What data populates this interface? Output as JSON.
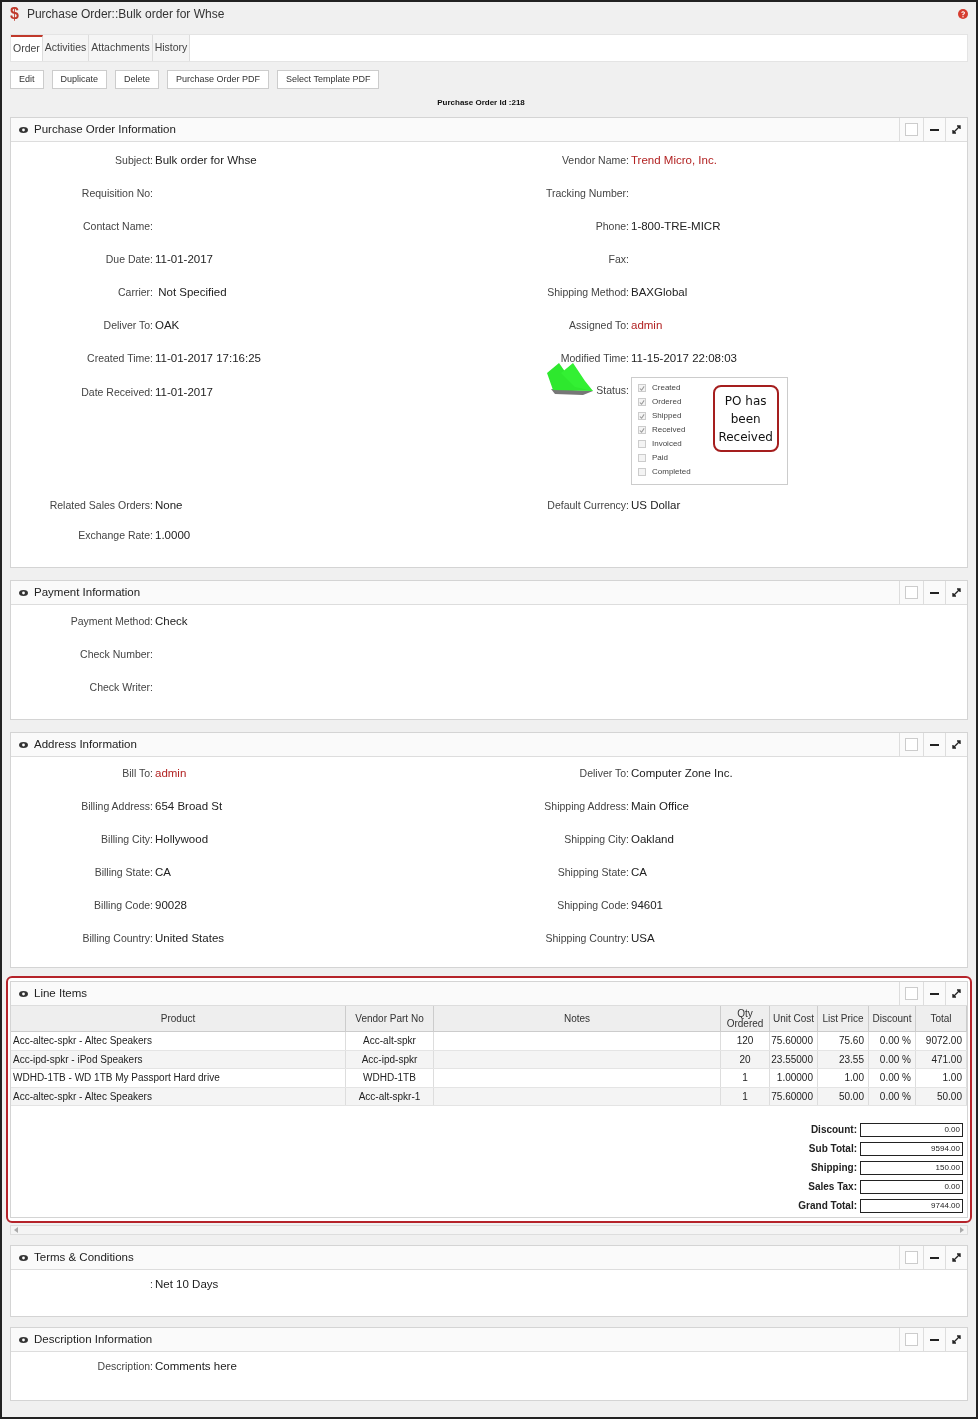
{
  "window": {
    "icon": "$",
    "title": "Purchase Order::Bulk order for Whse"
  },
  "tabs": [
    {
      "label": "Order",
      "selected": true
    },
    {
      "label": "Activities",
      "selected": false
    },
    {
      "label": "Attachments",
      "selected": false
    },
    {
      "label": "History",
      "selected": false
    }
  ],
  "buttons": [
    "Edit",
    "Duplicate",
    "Delete",
    "Purchase Order PDF",
    "Select Template PDF"
  ],
  "record_id": "Purchase Order Id :218",
  "po_info": {
    "title": "Purchase Order Information",
    "rows": [
      [
        {
          "label": "Subject:",
          "value": "Bulk order for Whse"
        },
        {
          "label": "Vendor Name:",
          "value": "Trend Micro, Inc.",
          "link": true
        }
      ],
      [
        {
          "label": "Requisition No:"
        },
        {
          "label": "Tracking Number:"
        }
      ],
      [
        {
          "label": "Contact Name:"
        },
        {
          "label": "Phone:",
          "value": "1-800-TRE-MICR"
        }
      ],
      [
        {
          "label": "Due Date:",
          "value": "11-01-2017"
        },
        {
          "label": "Fax:"
        }
      ],
      [
        {
          "label": "Carrier:",
          "value": " Not Specified"
        },
        {
          "label": "Shipping Method:",
          "value": "BAXGlobal"
        }
      ],
      [
        {
          "label": "Deliver To:",
          "value": "OAK"
        },
        {
          "label": "Assigned To:",
          "value": "admin",
          "link": true
        }
      ],
      [
        {
          "label": "Created Time:",
          "value": "11-01-2017 17:16:25"
        },
        {
          "label": "Modified Time:",
          "value": "11-15-2017 22:08:03"
        }
      ]
    ],
    "date_received": {
      "label": "Date Received:",
      "value": "11-01-2017"
    },
    "status": {
      "label": "Status:",
      "options": [
        {
          "label": "Created",
          "checked": true
        },
        {
          "label": "Ordered",
          "checked": true
        },
        {
          "label": "Shipped",
          "checked": true
        },
        {
          "label": "Received",
          "checked": true
        },
        {
          "label": "Invoiced",
          "checked": false
        },
        {
          "label": "Paid",
          "checked": false
        },
        {
          "label": "Completed",
          "checked": false
        }
      ],
      "callout": [
        "PO has",
        "been",
        "Received"
      ]
    },
    "rows_after": [
      [
        {
          "label": "Related Sales Orders:",
          "value": "None"
        },
        {
          "label": "Default Currency:",
          "value": "US Dollar"
        }
      ],
      [
        {
          "label": "Exchange Rate:",
          "value": "1.0000"
        }
      ]
    ]
  },
  "payment": {
    "title": "Payment Information",
    "rows": [
      [
        {
          "label": "Payment Method:",
          "value": "Check"
        }
      ],
      [
        {
          "label": "Check Number:"
        }
      ],
      [
        {
          "label": "Check Writer:"
        }
      ]
    ]
  },
  "address": {
    "title": "Address Information",
    "rows": [
      [
        {
          "label": "Bill To:",
          "value": "admin",
          "link": true
        },
        {
          "label": "Deliver To:",
          "value": "Computer Zone Inc."
        }
      ],
      [
        {
          "label": "Billing Address:",
          "value": "654 Broad St"
        },
        {
          "label": "Shipping Address:",
          "value": "Main Office"
        }
      ],
      [
        {
          "label": "Billing City:",
          "value": "Hollywood"
        },
        {
          "label": "Shipping City:",
          "value": "Oakland"
        }
      ],
      [
        {
          "label": "Billing State:",
          "value": "CA"
        },
        {
          "label": "Shipping State:",
          "value": "CA"
        }
      ],
      [
        {
          "label": "Billing Code:",
          "value": "90028"
        },
        {
          "label": "Shipping Code:",
          "value": "94601"
        }
      ],
      [
        {
          "label": "Billing Country:",
          "value": "United States"
        },
        {
          "label": "Shipping Country:",
          "value": "USA"
        }
      ]
    ]
  },
  "line_items": {
    "title": "Line Items",
    "columns": [
      "Product",
      "Vendor Part No",
      "Notes",
      "Qty Ordered",
      "Unit Cost",
      "List Price",
      "Discount",
      "Total"
    ],
    "rows": [
      [
        "Acc-altec-spkr - Altec Speakers",
        "Acc-alt-spkr",
        null,
        "120",
        "75.60000",
        "75.60",
        "0.00 %",
        "9072.00"
      ],
      [
        "Acc-ipd-spkr - iPod Speakers",
        "Acc-ipd-spkr",
        null,
        "20",
        "23.55000",
        "23.55",
        "0.00 %",
        "471.00"
      ],
      [
        "WDHD-1TB - WD 1TB My Passport Hard drive",
        "WDHD-1TB",
        null,
        "1",
        "1.00000",
        "1.00",
        "0.00 %",
        "1.00"
      ],
      [
        "Acc-altec-spkr - Altec Speakers",
        "Acc-alt-spkr-1",
        null,
        "1",
        "75.60000",
        "50.00",
        "0.00 %",
        "50.00"
      ]
    ],
    "totals": [
      {
        "label": "Discount:",
        "value": "0.00"
      },
      {
        "label": "Sub Total:",
        "value": "9594.00"
      },
      {
        "label": "Shipping:",
        "value": "150.00"
      },
      {
        "label": "Sales Tax:",
        "value": "0.00"
      },
      {
        "label": "Grand Total:",
        "value": "9744.00"
      }
    ]
  },
  "terms": {
    "title": "Terms & Conditions",
    "rows": [
      [
        {
          "label": ":",
          "value": "Net 10 Days"
        }
      ]
    ]
  },
  "description": {
    "title": "Description Information",
    "rows": [
      [
        {
          "label": "Description:",
          "value": "Comments here"
        }
      ]
    ]
  }
}
